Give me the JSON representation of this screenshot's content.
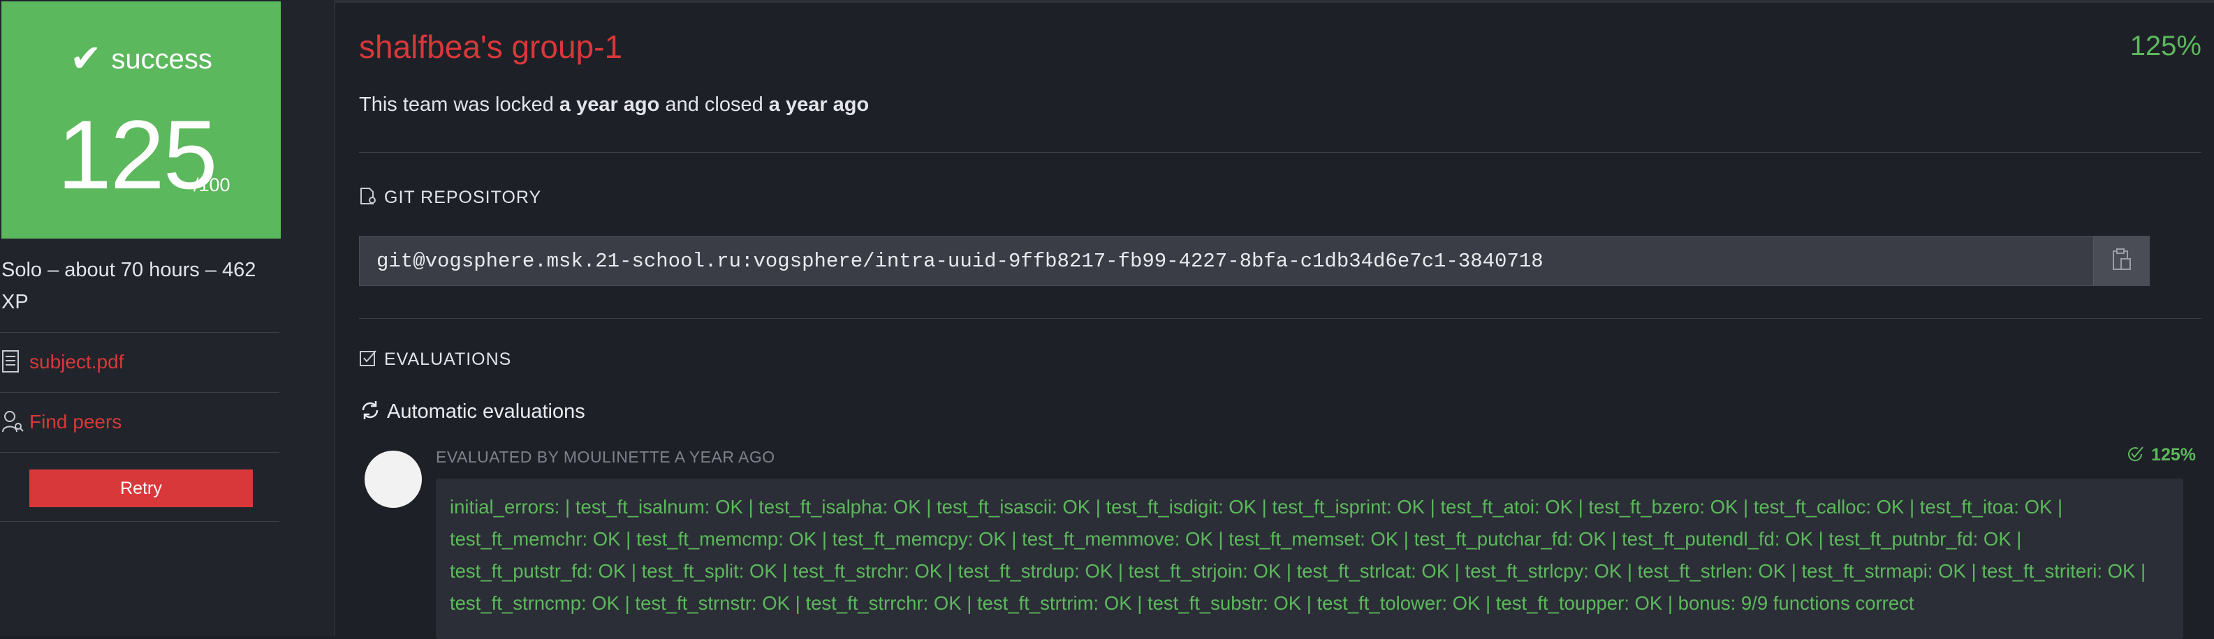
{
  "score": {
    "status": "success",
    "value": "125",
    "max": "/100"
  },
  "sidebar": {
    "info": "Solo – about 70 hours – 462 XP",
    "subject_link": "subject.pdf",
    "peers_link": "Find peers",
    "retry_label": "Retry"
  },
  "team": {
    "title": "shalfbea's group-1",
    "percent": "125%",
    "locked_prefix": "This team was locked ",
    "locked_when": "a year ago",
    "closed_prefix": " and closed ",
    "closed_when": "a year ago"
  },
  "git": {
    "section_label": "GIT REPOSITORY",
    "url": "git@vogsphere.msk.21-school.ru:vogsphere/intra-uuid-9ffb8217-fb99-4227-8bfa-c1db34d6e7c1-3840718"
  },
  "evaluations": {
    "section_label": "EVALUATIONS",
    "auto_label": "Automatic evaluations",
    "evaluated_by": "EVALUATED BY MOULINETTE A YEAR AGO",
    "percent": "125%",
    "result_text": "initial_errors:  | test_ft_isalnum: OK | test_ft_isalpha: OK | test_ft_isascii: OK | test_ft_isdigit: OK | test_ft_isprint: OK | test_ft_atoi: OK | test_ft_bzero: OK | test_ft_calloc: OK | test_ft_itoa: OK | test_ft_memchr: OK | test_ft_memcmp: OK | test_ft_memcpy: OK | test_ft_memmove: OK | test_ft_memset: OK | test_ft_putchar_fd: OK | test_ft_putendl_fd: OK | test_ft_putnbr_fd: OK | test_ft_putstr_fd: OK | test_ft_split: OK | test_ft_strchr: OK | test_ft_strdup: OK | test_ft_strjoin: OK | test_ft_strlcat: OK | test_ft_strlcpy: OK | test_ft_strlen: OK | test_ft_strmapi: OK | test_ft_striteri: OK | test_ft_strncmp: OK | test_ft_strnstr: OK | test_ft_strrchr: OK | test_ft_strtrim: OK | test_ft_substr: OK | test_ft_tolower: OK | test_ft_toupper: OK | bonus: 9/9 functions correct"
  },
  "icons": {
    "status": "check-icon",
    "subject": "document-icon",
    "peers": "user-search-icon",
    "git": "file-git-icon",
    "copy": "clipboard-icon",
    "evaluations": "checkbox-icon",
    "auto": "refresh-icon",
    "pass": "check-circle-icon"
  },
  "colors": {
    "success": "#5cb85c",
    "danger": "#d9383a",
    "background": "#1e2027"
  }
}
